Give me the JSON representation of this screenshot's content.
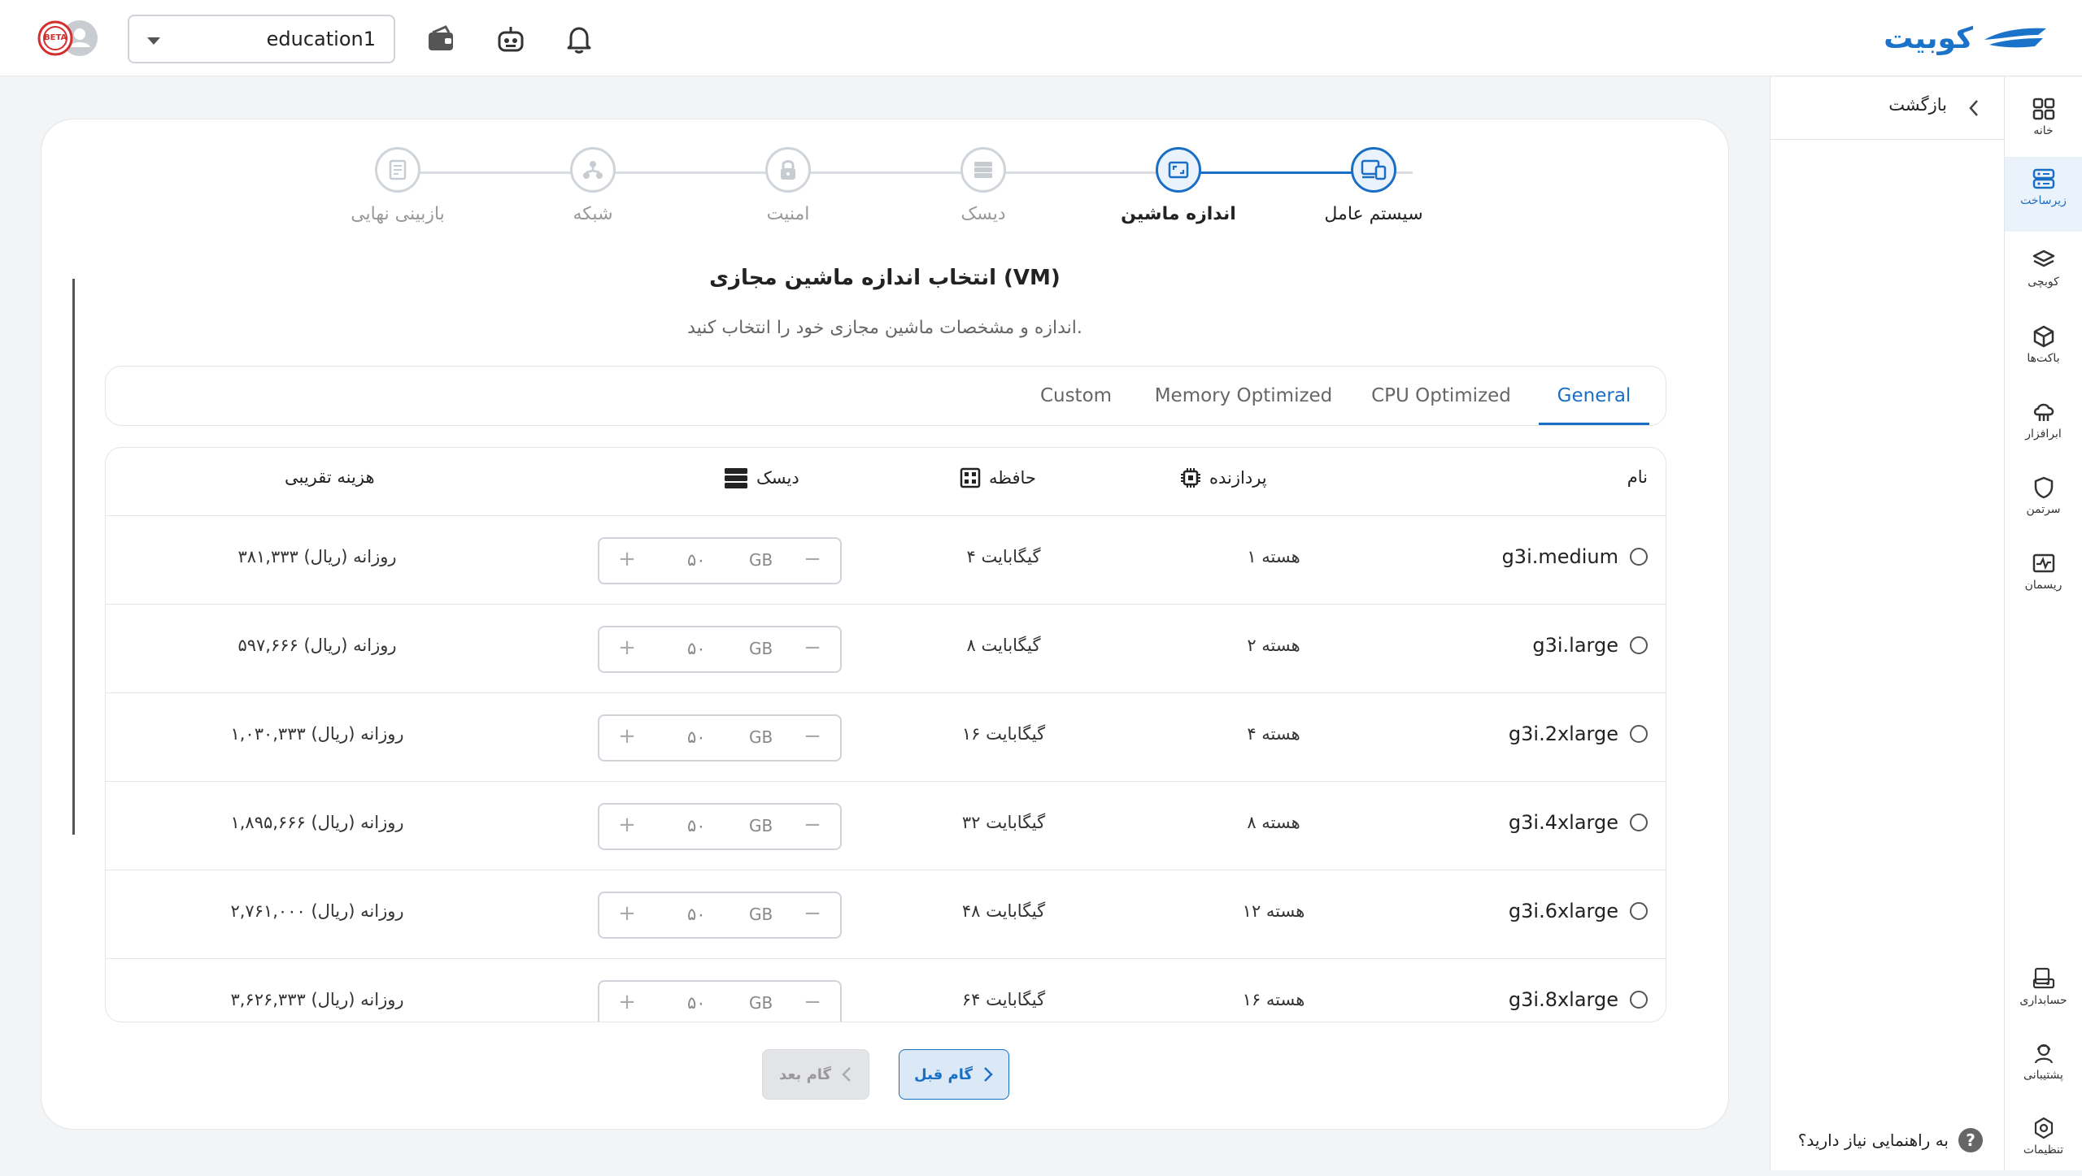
{
  "header": {
    "logo_text": "کوبیت",
    "workspace": "education1",
    "avatar_badge": "BETA"
  },
  "rail": {
    "items": [
      {
        "label": "خانه",
        "icon": "grid-icon"
      },
      {
        "label": "زیرساخت",
        "icon": "server-icon",
        "active": true
      },
      {
        "label": "کوبچی",
        "icon": "layers-icon"
      },
      {
        "label": "باکت‌ها",
        "icon": "box-icon"
      },
      {
        "label": "ابرافزار",
        "icon": "cloud-app-icon"
      },
      {
        "label": "سرتمن",
        "icon": "shield-icon"
      },
      {
        "label": "ریسمان",
        "icon": "pulse-icon"
      }
    ],
    "bottom_items": [
      {
        "label": "حسابداری",
        "icon": "accounting-icon"
      },
      {
        "label": "پشتیبانی",
        "icon": "support-icon"
      },
      {
        "label": "تنظیمات",
        "icon": "settings-icon"
      }
    ]
  },
  "subpanel": {
    "back_label": "بازگشت",
    "help_label": "به راهنمایی نیاز دارید؟",
    "help_icon": "?"
  },
  "steps": [
    {
      "label": "سیستم عامل",
      "state": "done"
    },
    {
      "label": "اندازه ماشین",
      "state": "current"
    },
    {
      "label": "دیسک",
      "state": "todo"
    },
    {
      "label": "امنیت",
      "state": "todo"
    },
    {
      "label": "شبکه",
      "state": "todo"
    },
    {
      "label": "بازبینی نهایی",
      "state": "todo"
    }
  ],
  "page": {
    "title": "انتخاب اندازه ماشین مجازی (VM)",
    "subtitle": "اندازه و مشخصات ماشین مجازی خود را انتخاب کنید."
  },
  "tabs": [
    {
      "label": "General",
      "active": true
    },
    {
      "label": "CPU Optimized"
    },
    {
      "label": "Memory Optimized"
    },
    {
      "label": "Custom"
    }
  ],
  "table": {
    "headers": {
      "name": "نام",
      "cpu": "پردازنده",
      "memory": "حافظه",
      "disk": "دیسک",
      "cost": "هزینه تقریبی"
    },
    "rows": [
      {
        "name": "g3i.medium",
        "cpu": "۱ هسته",
        "memory": "۴ گیگابایت",
        "disk": "۵۰",
        "unit": "GB",
        "cost": "۳۸۱,۳۳۳ روزانه (ریال)"
      },
      {
        "name": "g3i.large",
        "cpu": "۲ هسته",
        "memory": "۸ گیگابایت",
        "disk": "۵۰",
        "unit": "GB",
        "cost": "۵۹۷,۶۶۶ روزانه (ریال)"
      },
      {
        "name": "g3i.2xlarge",
        "cpu": "۴ هسته",
        "memory": "۱۶ گیگابایت",
        "disk": "۵۰",
        "unit": "GB",
        "cost": "۱,۰۳۰,۳۳۳ روزانه (ریال)"
      },
      {
        "name": "g3i.4xlarge",
        "cpu": "۸ هسته",
        "memory": "۳۲ گیگابایت",
        "disk": "۵۰",
        "unit": "GB",
        "cost": "۱,۸۹۵,۶۶۶ روزانه (ریال)"
      },
      {
        "name": "g3i.6xlarge",
        "cpu": "۱۲ هسته",
        "memory": "۴۸ گیگابایت",
        "disk": "۵۰",
        "unit": "GB",
        "cost": "۲,۷۶۱,۰۰۰ روزانه (ریال)"
      },
      {
        "name": "g3i.8xlarge",
        "cpu": "۱۶ هسته",
        "memory": "۶۴ گیگابایت",
        "disk": "۵۰",
        "unit": "GB",
        "cost": "۳,۶۲۶,۳۳۳ روزانه (ریال)"
      }
    ]
  },
  "buttons": {
    "prev": "گام قبل",
    "next": "گام بعد"
  },
  "colors": {
    "accent": "#1a6fc4",
    "background": "#f3f4f6"
  }
}
